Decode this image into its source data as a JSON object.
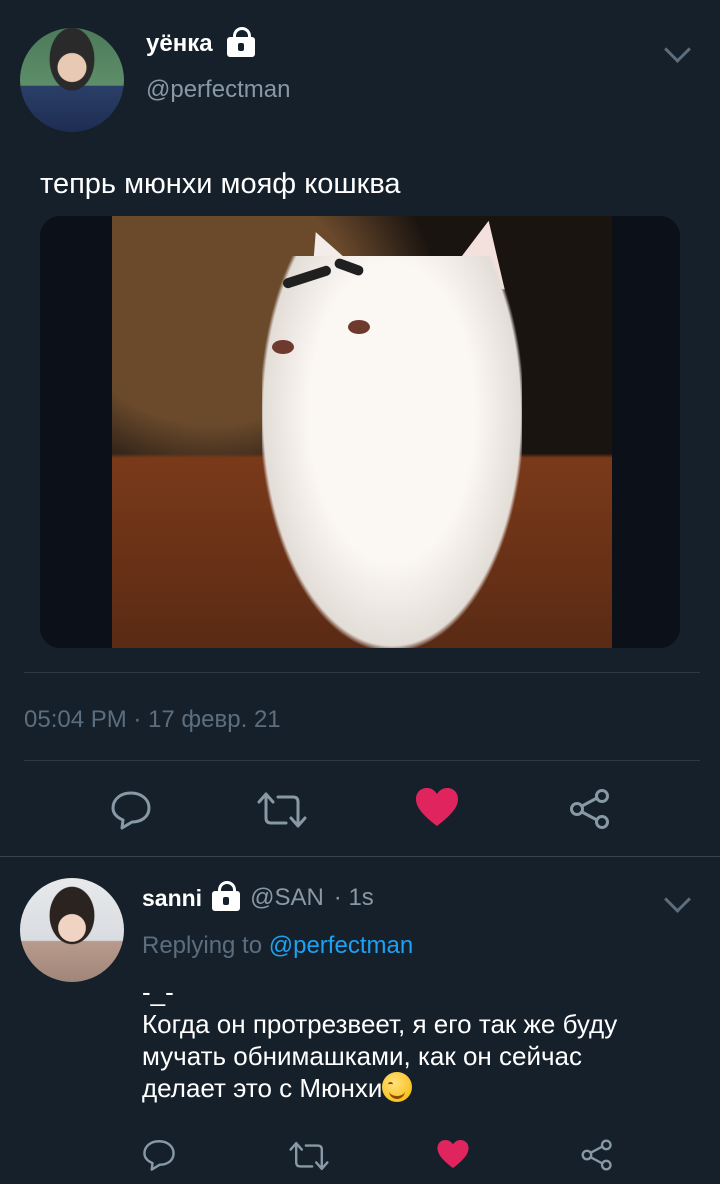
{
  "main_tweet": {
    "display_name": "уёнка",
    "handle": "@perfectman",
    "text": "тепрь мюнхи мояф кошква",
    "timestamp": "05:04 PM · 17 февр. 21",
    "locked": true,
    "liked": true
  },
  "reply_tweet": {
    "display_name": "sanni",
    "handle": "@SAN",
    "time": "· 1s",
    "replying_prefix": "Replying to",
    "replying_to": "@perfectman",
    "text_line1": "-_-",
    "text_line2": "Когда он протрезвеет, я его так же буду",
    "text_line3": "мучать обнимашками, как он сейчас",
    "text_line4": "делает это с Мюнхи",
    "emoji": "smiling-face-with-smiling-eyes",
    "locked": true,
    "liked": true
  },
  "actions": [
    "reply",
    "retweet",
    "like",
    "share"
  ],
  "colors": {
    "background": "#15202b",
    "text": "#ffffff",
    "muted": "#8899a6",
    "link": "#1da1f2",
    "like": "#e0245e"
  }
}
